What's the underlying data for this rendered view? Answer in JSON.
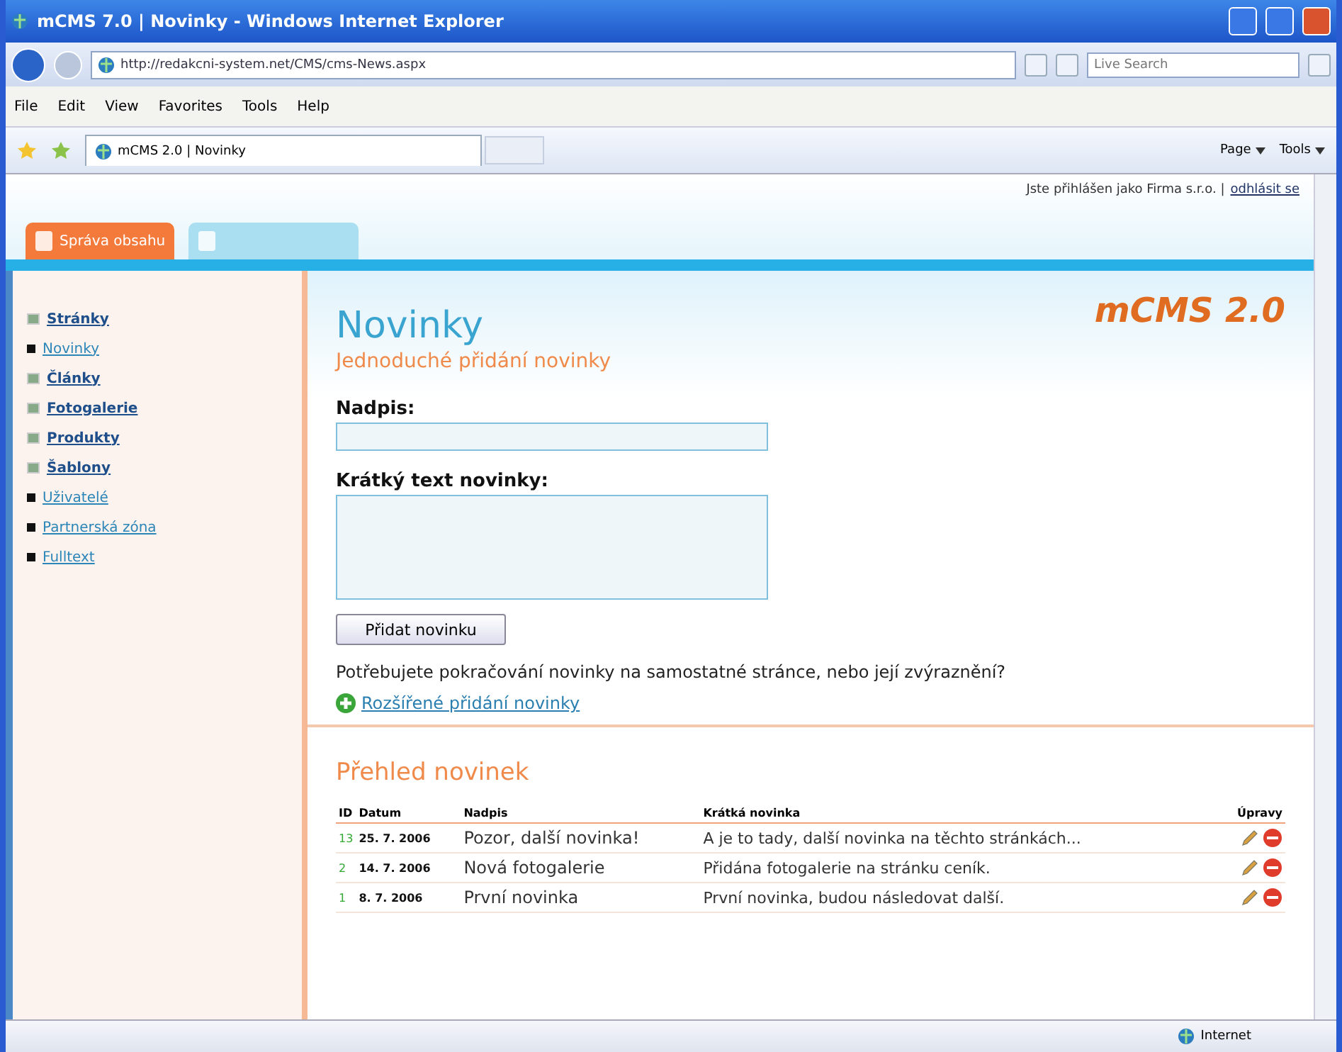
{
  "window": {
    "title": "mCMS 7.0 | Novinky - Windows Internet Explorer"
  },
  "address_bar": {
    "url": "http://redakcni-system.net/CMS/cms-News.aspx",
    "search_placeholder": "Live Search"
  },
  "menu": [
    "File",
    "Edit",
    "View",
    "Favorites",
    "Tools",
    "Help"
  ],
  "browser_tab": {
    "title": "mCMS 2.0 | Novinky"
  },
  "command_bar": [
    "Page",
    "Tools"
  ],
  "header": {
    "login_text": "Jste přihlášen jako Firma s.r.o. |",
    "logout_link": "odhlásit se"
  },
  "cms_tabs": [
    {
      "label": "Správa obsahu",
      "selected": true
    },
    {
      "selected": false
    }
  ],
  "sidebar": {
    "items": [
      {
        "label": "Stránky",
        "kind": "group"
      },
      {
        "label": "Novinky",
        "kind": "page"
      },
      {
        "label": "Články",
        "kind": "group"
      },
      {
        "label": "Fotogalerie",
        "kind": "group"
      },
      {
        "label": "Produkty",
        "kind": "group"
      },
      {
        "label": "Šablony",
        "kind": "group"
      },
      {
        "label": "Uživatelé",
        "kind": "page"
      },
      {
        "label": "Partnerská zóna",
        "kind": "page"
      },
      {
        "label": "Fulltext",
        "kind": "page"
      }
    ]
  },
  "main": {
    "title": "Novinky",
    "subtitle": "Jednoduché přidání novinky",
    "logo": "mCMS 2.0",
    "fields": [
      {
        "label": "Nadpis:",
        "kind": "input"
      },
      {
        "label": "Krátký text novinky:",
        "kind": "textarea"
      }
    ],
    "submit_button": "Přidat novinku",
    "hint": "Potřebujete pokračování novinky na samostatné stránce, nebo její zvýraznění?",
    "advanced_link": "Rozšířené přidání novinky"
  },
  "overview": {
    "title": "Přehled novinek",
    "columns": [
      "ID",
      "Datum",
      "Nadpis",
      "Krátká novinka",
      "Úpravy"
    ],
    "rows": [
      {
        "id": "13",
        "date": "25. 7. 2006",
        "title": "Pozor, další novinka!",
        "summary": "A je to tady, další novinka na těchto stránkách..."
      },
      {
        "id": "2",
        "date": "14. 7. 2006",
        "title": "Nová fotogalerie",
        "summary": "Přidána fotogalerie na stránku ceník."
      },
      {
        "id": "1",
        "date": "8. 7. 2006",
        "title": "První novinka",
        "summary": "První novinka, budou následovat další."
      }
    ]
  },
  "status_bar": {
    "zone": "Internet"
  }
}
